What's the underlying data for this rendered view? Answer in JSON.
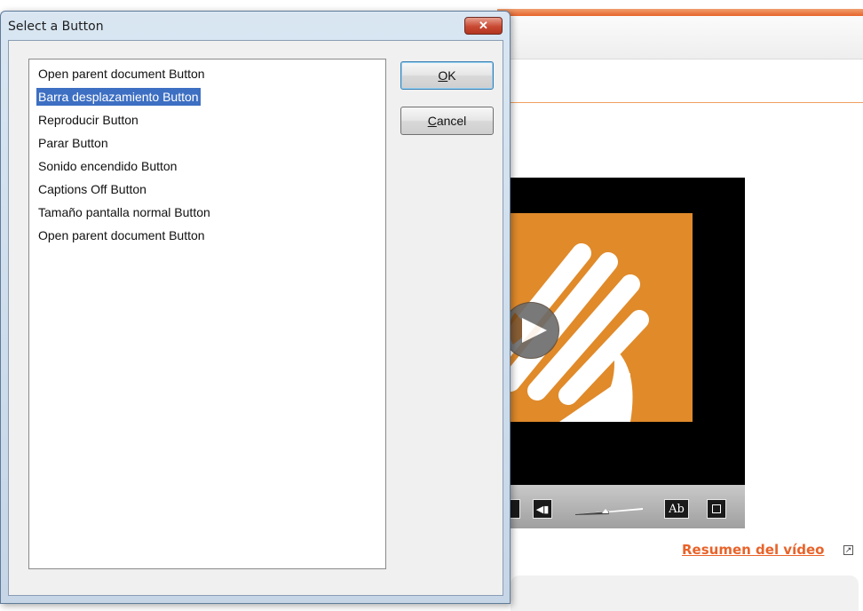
{
  "dialog": {
    "title": "Select a Button",
    "close_label": "✕",
    "items": [
      "Open parent document Button",
      "Barra desplazamiento Button",
      "Reproducir Button",
      "Parar Button",
      "Sonido encendido Button",
      "Captions Off Button",
      "Tamaño pantalla normal Button",
      "Open parent document Button"
    ],
    "selected_index": 1,
    "ok": {
      "mnemonic": "O",
      "rest": "K"
    },
    "cancel": {
      "mnemonic": "C",
      "rest": "ancel"
    }
  },
  "page": {
    "summary_link": "Resumen del vídeo",
    "captions_button": "Ab",
    "accent_color": "#e8632a",
    "video_color": "#e08a2a"
  }
}
